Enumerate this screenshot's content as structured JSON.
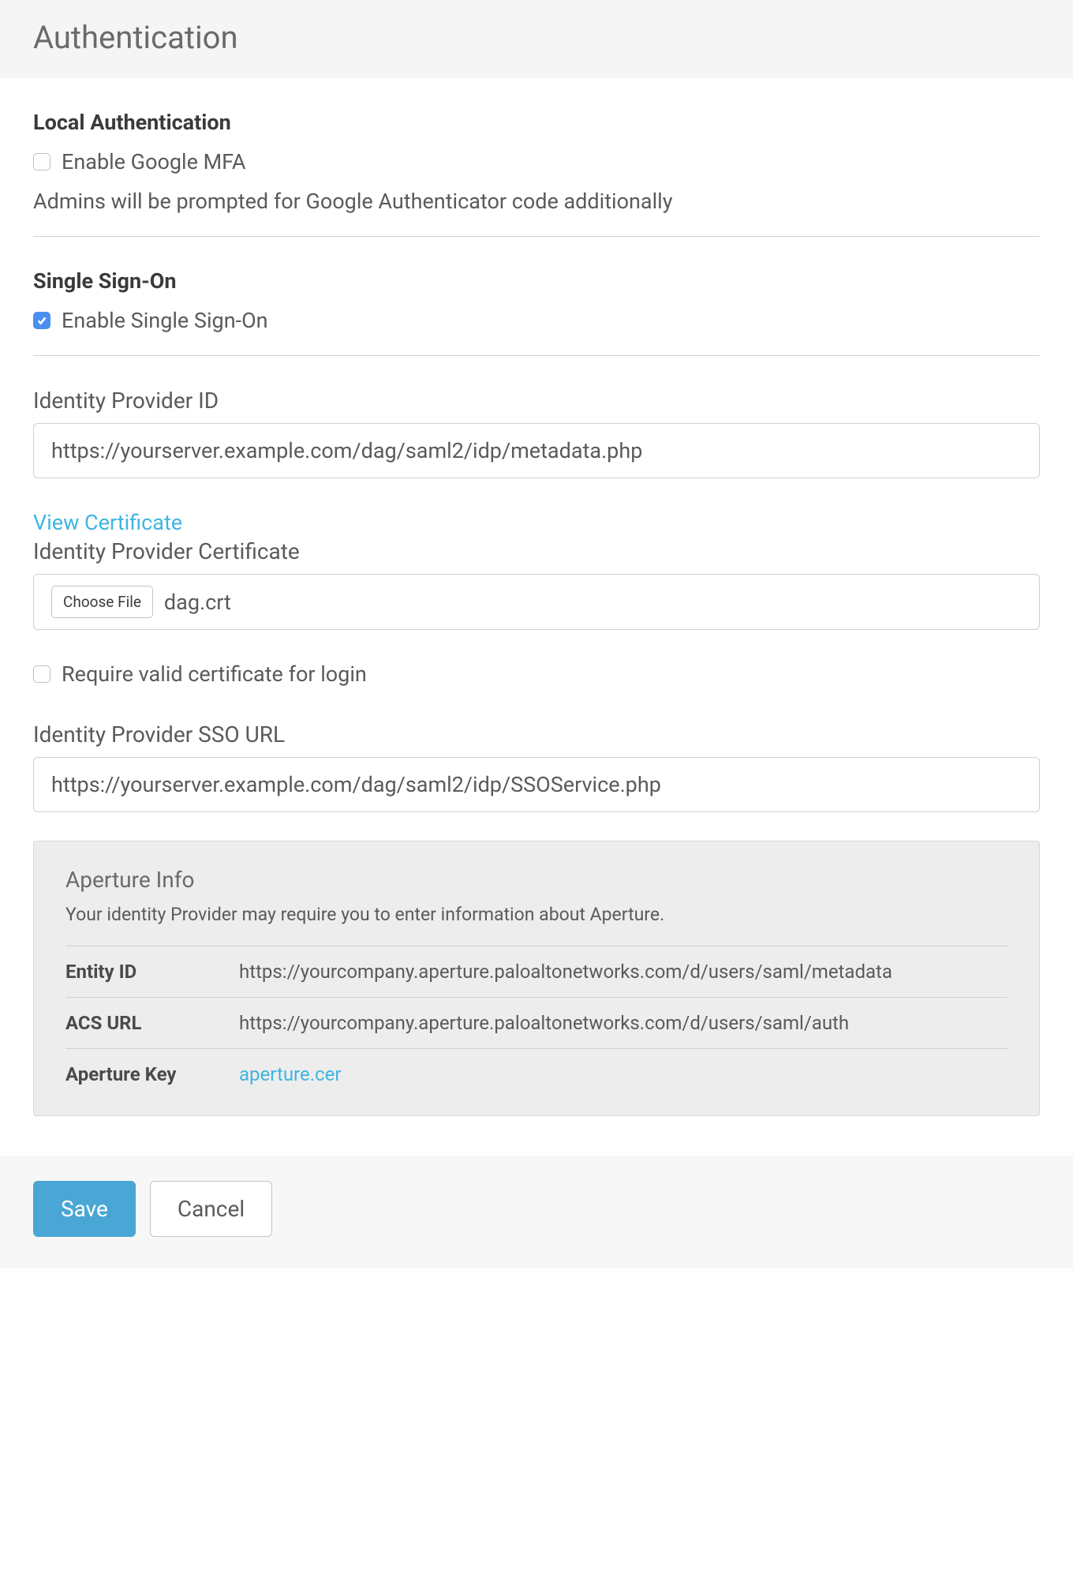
{
  "header": {
    "title": "Authentication"
  },
  "local_auth": {
    "heading": "Local Authentication",
    "enable_mfa_label": "Enable Google MFA",
    "enable_mfa_checked": false,
    "help_text": "Admins will be prompted for Google Authenticator code additionally"
  },
  "sso": {
    "heading": "Single Sign-On",
    "enable_sso_label": "Enable Single Sign-On",
    "enable_sso_checked": true,
    "idp_id_label": "Identity Provider ID",
    "idp_id_value": "https://yourserver.example.com/dag/saml2/idp/metadata.php",
    "view_cert_label": "View Certificate",
    "idp_cert_label": "Identity Provider Certificate",
    "choose_file_label": "Choose File",
    "cert_file_name": "dag.crt",
    "require_valid_cert_label": "Require valid certificate for login",
    "require_valid_cert_checked": false,
    "idp_sso_url_label": "Identity Provider SSO URL",
    "idp_sso_url_value": "https://yourserver.example.com/dag/saml2/idp/SSOService.php"
  },
  "aperture": {
    "title": "Aperture Info",
    "description": "Your identity Provider may require you to enter information about Aperture.",
    "rows": [
      {
        "key": "Entity ID",
        "value": "https://yourcompany.aperture.paloaltonetworks.com/d/users/saml/metadata",
        "is_link": false
      },
      {
        "key": "ACS URL",
        "value": "https://yourcompany.aperture.paloaltonetworks.com/d/users/saml/auth",
        "is_link": false
      },
      {
        "key": "Aperture Key",
        "value": "aperture.cer",
        "is_link": true
      }
    ]
  },
  "footer": {
    "save_label": "Save",
    "cancel_label": "Cancel"
  }
}
